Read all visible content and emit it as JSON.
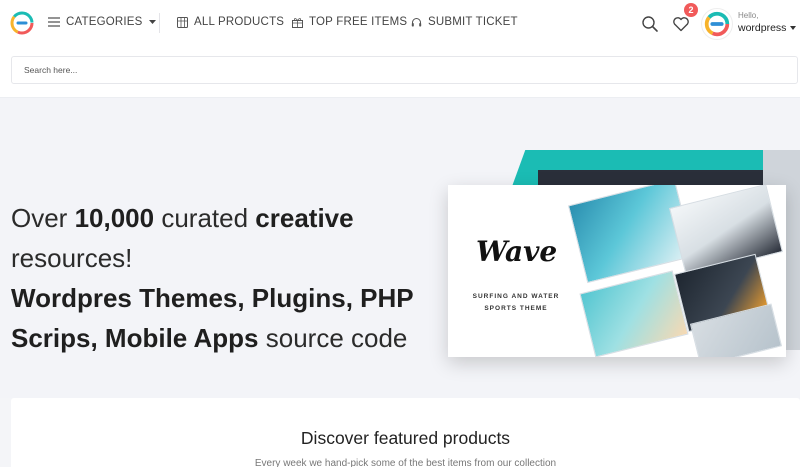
{
  "header": {
    "logo_icon": "brand-logo-icon",
    "nav": {
      "categories": "CATEGORIES",
      "all_products": "ALL PRODUCTS",
      "top_free_items": "TOP FREE ITEMS",
      "submit_ticket": "SUBMIT TICKET"
    },
    "favorites_count": "2",
    "user": {
      "greeting": "Hello,",
      "name": "wordpress"
    }
  },
  "search": {
    "placeholder": "Search here..."
  },
  "hero": {
    "line1_a": "Over ",
    "line1_b": "10,000",
    "line1_c": " curated ",
    "line1_d": "creative",
    "line2": "resources!",
    "line3": "Wordpres Themes, Plugins, PHP",
    "line4_a": "Scrips, Mobile Apps",
    "line4_b": " source code",
    "collage": {
      "logo_text": "Wave",
      "subtitle": "SURFING AND WATER SPORTS THEME"
    }
  },
  "featured": {
    "title": "Discover featured products",
    "subtitle": "Every week we hand-pick some of the best items from our collection"
  },
  "colors": {
    "accent": "#1bbcb4",
    "badge": "#f15a5a",
    "hero_bg": "#f3f4f8"
  }
}
